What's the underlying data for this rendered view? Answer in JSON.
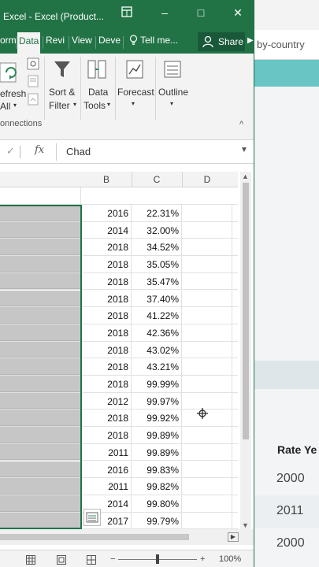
{
  "window": {
    "title": "Excel - Excel (Product...",
    "controls": {
      "ribbon_options_icon": "ribbon-display-icon",
      "minimize": "–",
      "maximize": "□",
      "close": "✕"
    }
  },
  "tabs": [
    {
      "label": "orm"
    },
    {
      "label": "Data",
      "active": true
    },
    {
      "label": "Revi"
    },
    {
      "label": "View"
    },
    {
      "label": "Deve"
    },
    {
      "label": "Tell me..."
    }
  ],
  "share_label": "Share",
  "ribbon": {
    "refresh_label_1": "efresh",
    "refresh_label_2": "All",
    "connections_label": "onnections",
    "sort_filter_1": "Sort &",
    "sort_filter_2": "Filter",
    "data_tools_1": "Data",
    "data_tools_2": "Tools",
    "forecast": "Forecast",
    "outline": "Outline"
  },
  "formula_bar": {
    "fx": "fx",
    "value": "Chad"
  },
  "columns": [
    "B",
    "C",
    "D"
  ],
  "rows": [
    {
      "b": "2016",
      "c": "22.31%"
    },
    {
      "b": "2014",
      "c": "32.00%"
    },
    {
      "b": "2018",
      "c": "34.52%"
    },
    {
      "b": "2018",
      "c": "35.05%"
    },
    {
      "b": "2018",
      "c": "35.47%"
    },
    {
      "b": "2018",
      "c": "37.40%"
    },
    {
      "b": "2018",
      "c": "41.22%"
    },
    {
      "b": "2018",
      "c": "42.36%"
    },
    {
      "b": "2018",
      "c": "43.02%"
    },
    {
      "b": "2018",
      "c": "43.21%"
    },
    {
      "b": "2018",
      "c": "99.99%"
    },
    {
      "b": "2012",
      "c": "99.97%"
    },
    {
      "b": "2018",
      "c": "99.92%"
    },
    {
      "b": "2018",
      "c": "99.89%"
    },
    {
      "b": "2011",
      "c": "99.89%"
    },
    {
      "b": "2016",
      "c": "99.83%"
    },
    {
      "b": "2011",
      "c": "99.82%"
    },
    {
      "b": "2014",
      "c": "99.80%"
    },
    {
      "b": "2017",
      "c": "99.79%"
    }
  ],
  "status": {
    "zoom": "100%"
  },
  "background_page": {
    "url_fragment": "by-country",
    "table_header": "Rate Ye",
    "years": [
      "2000",
      "2011",
      "2000"
    ]
  }
}
